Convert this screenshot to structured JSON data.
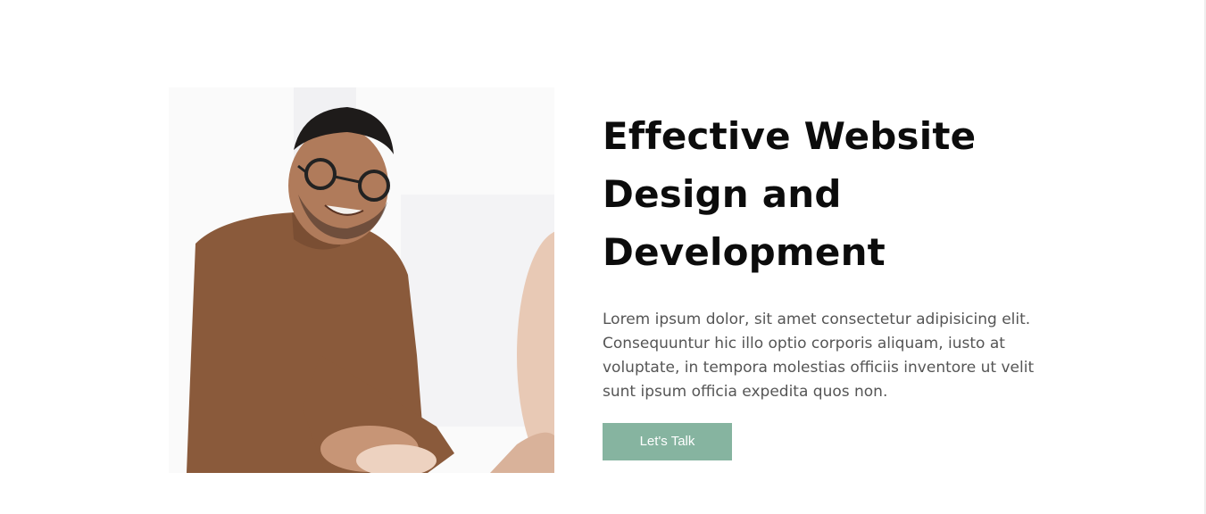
{
  "hero": {
    "title_lines": [
      "Effective Website",
      "Design and",
      "Development"
    ],
    "description_lines": [
      "Lorem ipsum dolor, sit amet consectetur adipisicing elit.",
      "Consequuntur hic illo optio corporis aliquam, iusto at",
      "voluptate, in tempora molestias officiis inventore ut velit",
      "sunt ipsum officia expedita quos non."
    ],
    "cta_label": "Let's Talk"
  },
  "colors": {
    "accent": "#86b4a0",
    "heading": "#0c0c0c",
    "body_text": "#555555",
    "sweater": "#8a5a3b"
  }
}
